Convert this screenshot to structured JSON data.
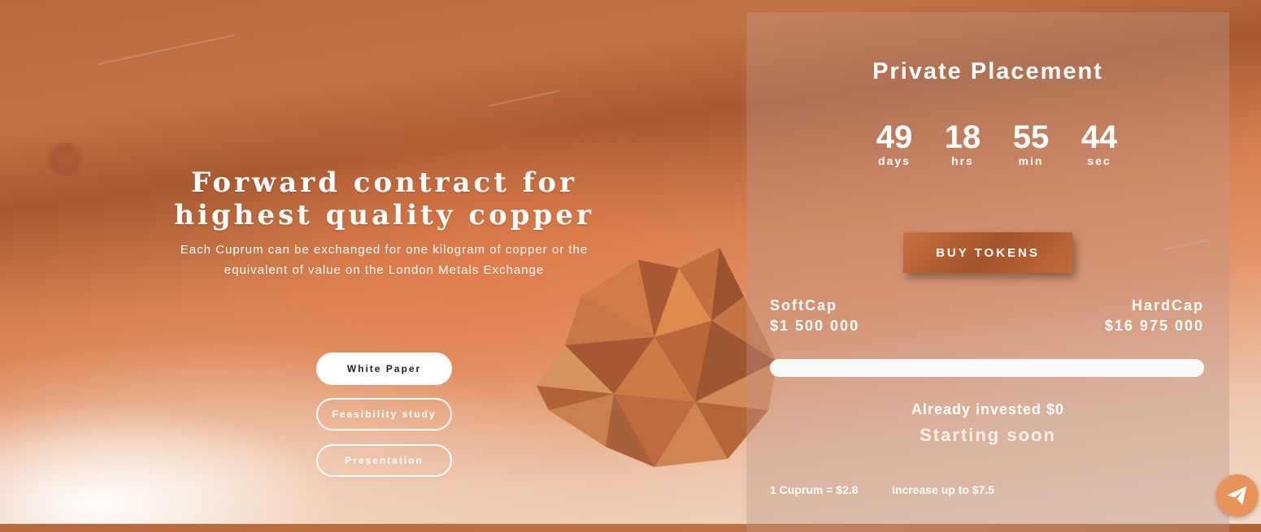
{
  "hero": {
    "title_line1": "Forward contract for",
    "title_line2": "highest quality copper",
    "subtitle_line1": "Each Cuprum can be exchanged for one kilogram of copper or the",
    "subtitle_line2": "equivalent of value on the London Metals Exchange"
  },
  "buttons": {
    "white_paper": "White Paper",
    "feasibility": "Feasibility study",
    "presentation": "Presentation"
  },
  "panel": {
    "title": "Private Placement",
    "countdown": [
      {
        "value": "49",
        "label": "days"
      },
      {
        "value": "18",
        "label": "hrs"
      },
      {
        "value": "55",
        "label": "min"
      },
      {
        "value": "44",
        "label": "sec"
      }
    ],
    "buy_label": "BUY TOKENS",
    "softcap_label": "SoftCap",
    "softcap_value": "$1 500 000",
    "hardcap_label": "HardCap",
    "hardcap_value": "$16 975 000",
    "progress_fraction": 0,
    "invested_label": "Already invested",
    "invested_value": "$0",
    "status": "Starting soon",
    "price_text": "1 Cuprum = $2.8",
    "increase_text": "increase up to $7.5"
  },
  "icons": {
    "telegram": "paper-plane-icon",
    "crystal": "copper-crystal"
  },
  "colors": {
    "accent": "#c46a3a",
    "telegram_bg": "#e8925c"
  }
}
